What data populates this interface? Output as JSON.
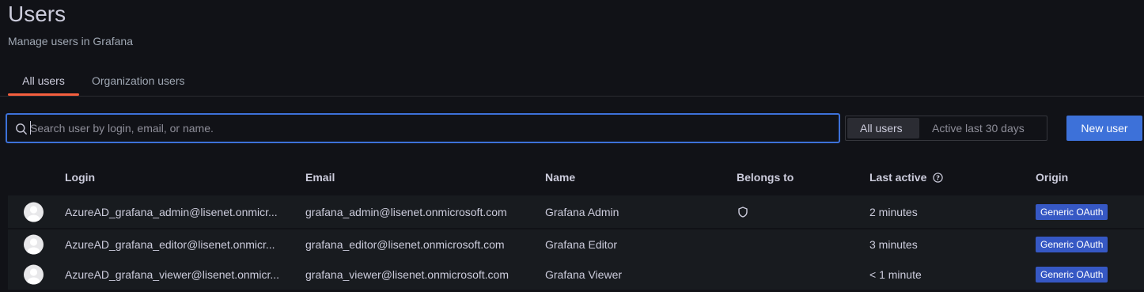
{
  "header": {
    "title": "Users",
    "subtitle": "Manage users in Grafana"
  },
  "tabs": [
    {
      "label": "All users",
      "active": true
    },
    {
      "label": "Organization users",
      "active": false
    }
  ],
  "search": {
    "placeholder": "Search user by login, email, or name.",
    "value": ""
  },
  "filter": {
    "options": [
      "All users",
      "Active last 30 days"
    ],
    "selected": "All users"
  },
  "actions": {
    "new_user_label": "New user"
  },
  "table": {
    "columns": [
      "Login",
      "Email",
      "Name",
      "Belongs to",
      "Last active",
      "Origin"
    ],
    "rows": [
      {
        "login": "AzureAD_grafana_admin@lisenet.onmicr...",
        "email": "grafana_admin@lisenet.onmicrosoft.com",
        "name": "Grafana Admin",
        "belongs_icon": "shield-icon",
        "last_active": "2 minutes",
        "origin": "Generic OAuth"
      },
      {
        "login": "AzureAD_grafana_editor@lisenet.onmicr...",
        "email": "grafana_editor@lisenet.onmicrosoft.com",
        "name": "Grafana Editor",
        "belongs_icon": "",
        "last_active": "3 minutes",
        "origin": "Generic OAuth"
      },
      {
        "login": "AzureAD_grafana_viewer@lisenet.onmicr...",
        "email": "grafana_viewer@lisenet.onmicrosoft.com",
        "name": "Grafana Viewer",
        "belongs_icon": "",
        "last_active": "< 1 minute",
        "origin": "Generic OAuth"
      }
    ]
  },
  "colors": {
    "background": "#111217",
    "row_background": "#181b1f",
    "accent": "#3d71d9",
    "tab_underline": "#f55f3e",
    "badge": "#3658c4"
  }
}
